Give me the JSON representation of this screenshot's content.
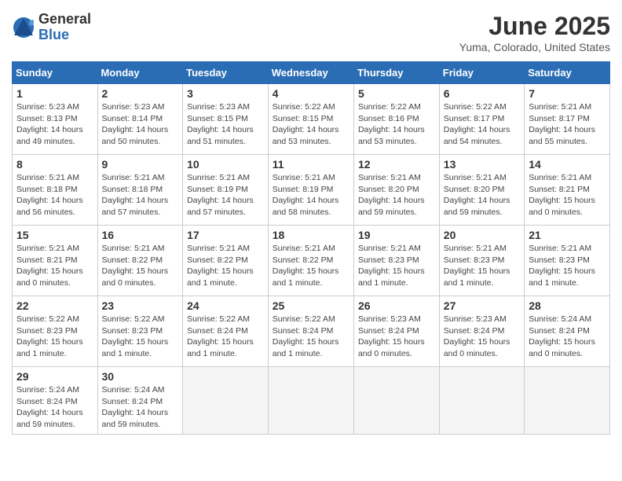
{
  "logo": {
    "general": "General",
    "blue": "Blue"
  },
  "title": "June 2025",
  "location": "Yuma, Colorado, United States",
  "days_of_week": [
    "Sunday",
    "Monday",
    "Tuesday",
    "Wednesday",
    "Thursday",
    "Friday",
    "Saturday"
  ],
  "weeks": [
    [
      {
        "day": "1",
        "info": "Sunrise: 5:23 AM\nSunset: 8:13 PM\nDaylight: 14 hours\nand 49 minutes."
      },
      {
        "day": "2",
        "info": "Sunrise: 5:23 AM\nSunset: 8:14 PM\nDaylight: 14 hours\nand 50 minutes."
      },
      {
        "day": "3",
        "info": "Sunrise: 5:23 AM\nSunset: 8:15 PM\nDaylight: 14 hours\nand 51 minutes."
      },
      {
        "day": "4",
        "info": "Sunrise: 5:22 AM\nSunset: 8:15 PM\nDaylight: 14 hours\nand 53 minutes."
      },
      {
        "day": "5",
        "info": "Sunrise: 5:22 AM\nSunset: 8:16 PM\nDaylight: 14 hours\nand 53 minutes."
      },
      {
        "day": "6",
        "info": "Sunrise: 5:22 AM\nSunset: 8:17 PM\nDaylight: 14 hours\nand 54 minutes."
      },
      {
        "day": "7",
        "info": "Sunrise: 5:21 AM\nSunset: 8:17 PM\nDaylight: 14 hours\nand 55 minutes."
      }
    ],
    [
      {
        "day": "8",
        "info": "Sunrise: 5:21 AM\nSunset: 8:18 PM\nDaylight: 14 hours\nand 56 minutes."
      },
      {
        "day": "9",
        "info": "Sunrise: 5:21 AM\nSunset: 8:18 PM\nDaylight: 14 hours\nand 57 minutes."
      },
      {
        "day": "10",
        "info": "Sunrise: 5:21 AM\nSunset: 8:19 PM\nDaylight: 14 hours\nand 57 minutes."
      },
      {
        "day": "11",
        "info": "Sunrise: 5:21 AM\nSunset: 8:19 PM\nDaylight: 14 hours\nand 58 minutes."
      },
      {
        "day": "12",
        "info": "Sunrise: 5:21 AM\nSunset: 8:20 PM\nDaylight: 14 hours\nand 59 minutes."
      },
      {
        "day": "13",
        "info": "Sunrise: 5:21 AM\nSunset: 8:20 PM\nDaylight: 14 hours\nand 59 minutes."
      },
      {
        "day": "14",
        "info": "Sunrise: 5:21 AM\nSunset: 8:21 PM\nDaylight: 15 hours\nand 0 minutes."
      }
    ],
    [
      {
        "day": "15",
        "info": "Sunrise: 5:21 AM\nSunset: 8:21 PM\nDaylight: 15 hours\nand 0 minutes."
      },
      {
        "day": "16",
        "info": "Sunrise: 5:21 AM\nSunset: 8:22 PM\nDaylight: 15 hours\nand 0 minutes."
      },
      {
        "day": "17",
        "info": "Sunrise: 5:21 AM\nSunset: 8:22 PM\nDaylight: 15 hours\nand 1 minute."
      },
      {
        "day": "18",
        "info": "Sunrise: 5:21 AM\nSunset: 8:22 PM\nDaylight: 15 hours\nand 1 minute."
      },
      {
        "day": "19",
        "info": "Sunrise: 5:21 AM\nSunset: 8:23 PM\nDaylight: 15 hours\nand 1 minute."
      },
      {
        "day": "20",
        "info": "Sunrise: 5:21 AM\nSunset: 8:23 PM\nDaylight: 15 hours\nand 1 minute."
      },
      {
        "day": "21",
        "info": "Sunrise: 5:21 AM\nSunset: 8:23 PM\nDaylight: 15 hours\nand 1 minute."
      }
    ],
    [
      {
        "day": "22",
        "info": "Sunrise: 5:22 AM\nSunset: 8:23 PM\nDaylight: 15 hours\nand 1 minute."
      },
      {
        "day": "23",
        "info": "Sunrise: 5:22 AM\nSunset: 8:23 PM\nDaylight: 15 hours\nand 1 minute."
      },
      {
        "day": "24",
        "info": "Sunrise: 5:22 AM\nSunset: 8:24 PM\nDaylight: 15 hours\nand 1 minute."
      },
      {
        "day": "25",
        "info": "Sunrise: 5:22 AM\nSunset: 8:24 PM\nDaylight: 15 hours\nand 1 minute."
      },
      {
        "day": "26",
        "info": "Sunrise: 5:23 AM\nSunset: 8:24 PM\nDaylight: 15 hours\nand 0 minutes."
      },
      {
        "day": "27",
        "info": "Sunrise: 5:23 AM\nSunset: 8:24 PM\nDaylight: 15 hours\nand 0 minutes."
      },
      {
        "day": "28",
        "info": "Sunrise: 5:24 AM\nSunset: 8:24 PM\nDaylight: 15 hours\nand 0 minutes."
      }
    ],
    [
      {
        "day": "29",
        "info": "Sunrise: 5:24 AM\nSunset: 8:24 PM\nDaylight: 14 hours\nand 59 minutes."
      },
      {
        "day": "30",
        "info": "Sunrise: 5:24 AM\nSunset: 8:24 PM\nDaylight: 14 hours\nand 59 minutes."
      },
      {
        "day": "",
        "info": ""
      },
      {
        "day": "",
        "info": ""
      },
      {
        "day": "",
        "info": ""
      },
      {
        "day": "",
        "info": ""
      },
      {
        "day": "",
        "info": ""
      }
    ]
  ]
}
